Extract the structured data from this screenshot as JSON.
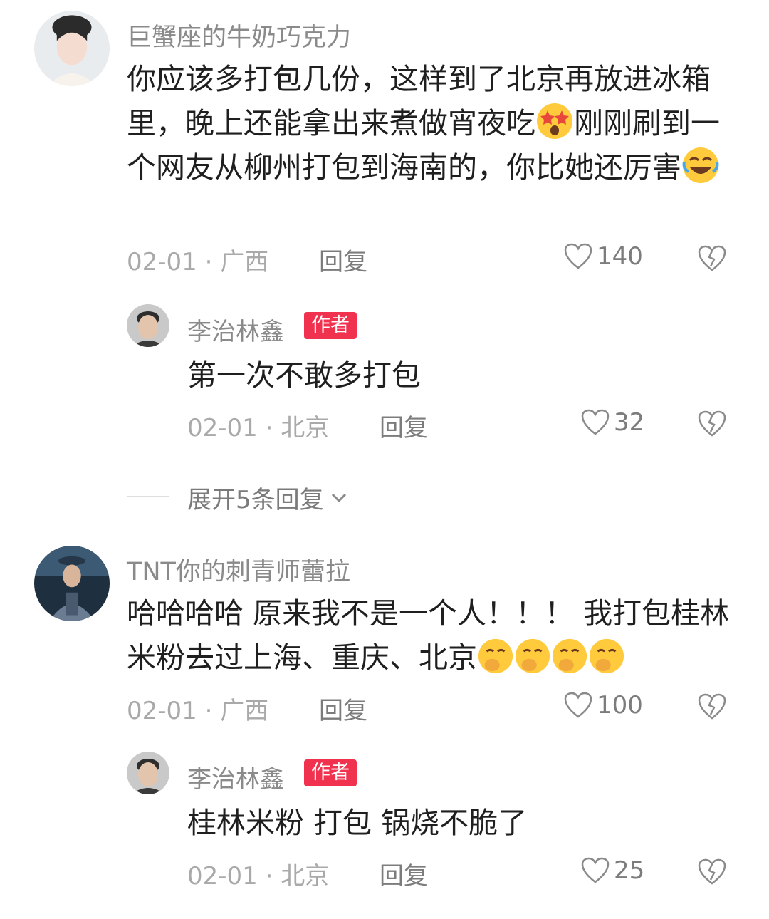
{
  "comments": [
    {
      "username": "巨蟹座的牛奶巧克力",
      "text_parts": [
        "你应该多打包几份，这样到了北京再放进冰箱里，晚上还能拿出来煮做宵夜吃",
        "刚刚刷到一个网友从柳州打包到海南的，你比她还厉害"
      ],
      "emojis": [
        "star-eyes-emoji",
        "rofl-emoji"
      ],
      "date": "02-01",
      "location": "广西",
      "reply_label": "回复",
      "likes": "140",
      "replies": [
        {
          "username": "李治林鑫",
          "badge": "作者",
          "text": "第一次不敢多打包",
          "date": "02-01",
          "location": "北京",
          "reply_label": "回复",
          "likes": "32"
        }
      ],
      "expand_label": "展开5条回复"
    },
    {
      "username": "TNT你的刺青师蕾拉",
      "text": "哈哈哈哈 原来我不是一个人！！！ 我打包桂林米粉去过上海、重庆、北京",
      "emojis": [
        "giggle-emoji",
        "giggle-emoji",
        "giggle-emoji",
        "giggle-emoji"
      ],
      "date": "02-01",
      "location": "广西",
      "reply_label": "回复",
      "likes": "100",
      "replies": [
        {
          "username": "李治林鑫",
          "badge": "作者",
          "text": "桂林米粉 打包 锅烧不脆了",
          "date": "02-01",
          "location": "北京",
          "reply_label": "回复",
          "likes": "25"
        }
      ]
    }
  ],
  "colors": {
    "badge": "#f0324f",
    "username": "#8a8a8a",
    "meta": "#a9a9a9",
    "text": "#1f1f1f"
  }
}
